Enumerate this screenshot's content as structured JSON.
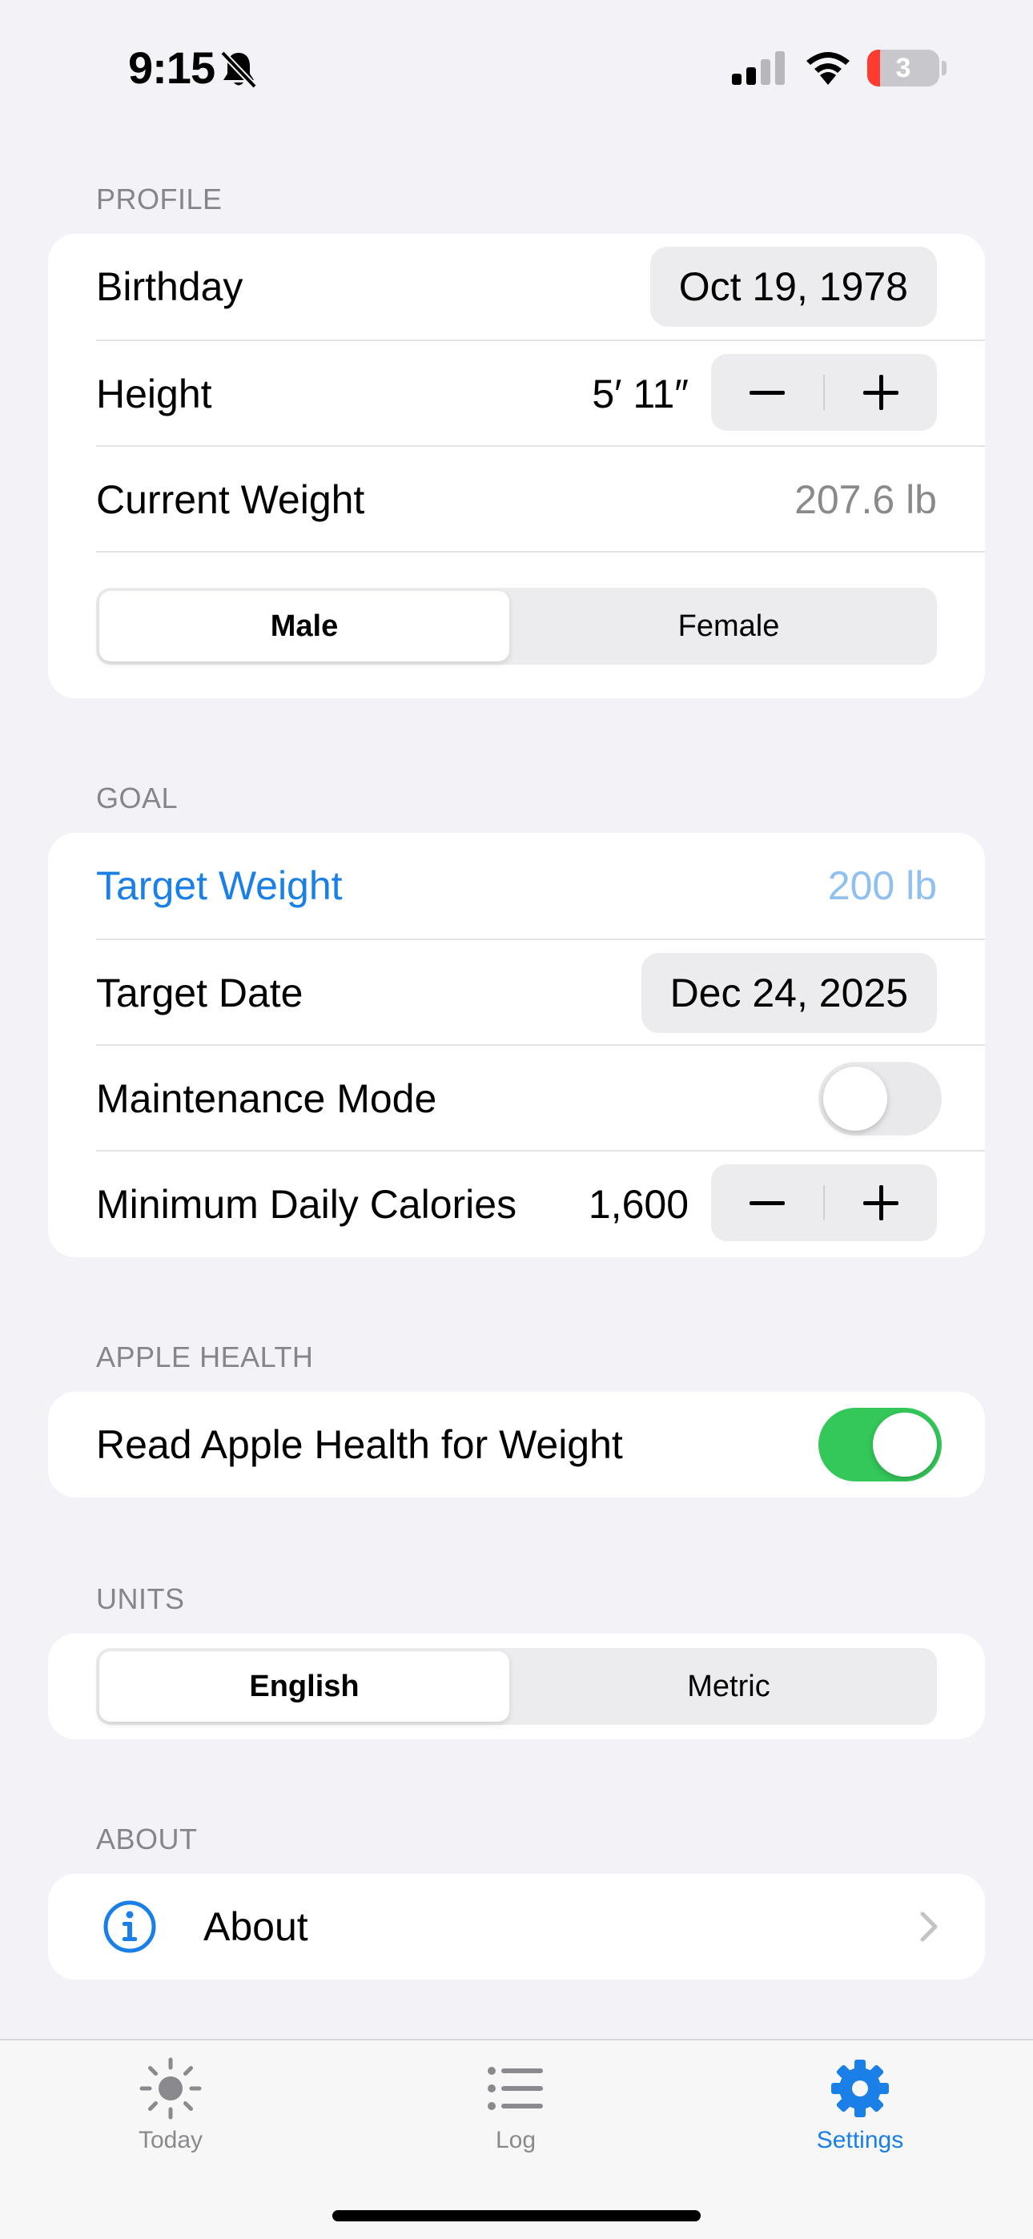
{
  "status_bar": {
    "time": "9:15",
    "battery_level": "3",
    "icons": [
      "bell-slash-icon",
      "cellular-signal-icon",
      "wifi-icon",
      "battery-icon"
    ]
  },
  "profile": {
    "header": "PROFILE",
    "birthday_label": "Birthday",
    "birthday_value": "Oct 19, 1978",
    "height_label": "Height",
    "height_value": "5′ 11″",
    "current_weight_label": "Current Weight",
    "current_weight_value": "207.6 lb",
    "sex_options": [
      "Male",
      "Female"
    ],
    "sex_selected": "Male"
  },
  "goal": {
    "header": "GOAL",
    "target_weight_label": "Target Weight",
    "target_weight_value": "200 lb",
    "target_date_label": "Target Date",
    "target_date_value": "Dec 24, 2025",
    "maintenance_label": "Maintenance Mode",
    "maintenance_on": false,
    "min_calories_label": "Minimum Daily Calories",
    "min_calories_value": "1,600"
  },
  "apple_health": {
    "header": "APPLE HEALTH",
    "read_weight_label": "Read Apple Health for Weight",
    "read_weight_on": true
  },
  "units": {
    "header": "UNITS",
    "options": [
      "English",
      "Metric"
    ],
    "selected": "English"
  },
  "about": {
    "header": "ABOUT",
    "label": "About",
    "icon": "info-circle-icon"
  },
  "tabs": [
    {
      "label": "Today",
      "icon": "sun-icon",
      "selected": false
    },
    {
      "label": "Log",
      "icon": "list-icon",
      "selected": false
    },
    {
      "label": "Settings",
      "icon": "gear-icon",
      "selected": true
    }
  ],
  "colors": {
    "accent": "#1a7fe6",
    "accent_light": "#8fc0ef",
    "toggle_on": "#34c759",
    "tab_inactive": "#8a8a8e",
    "background": "#f2f2f7"
  }
}
